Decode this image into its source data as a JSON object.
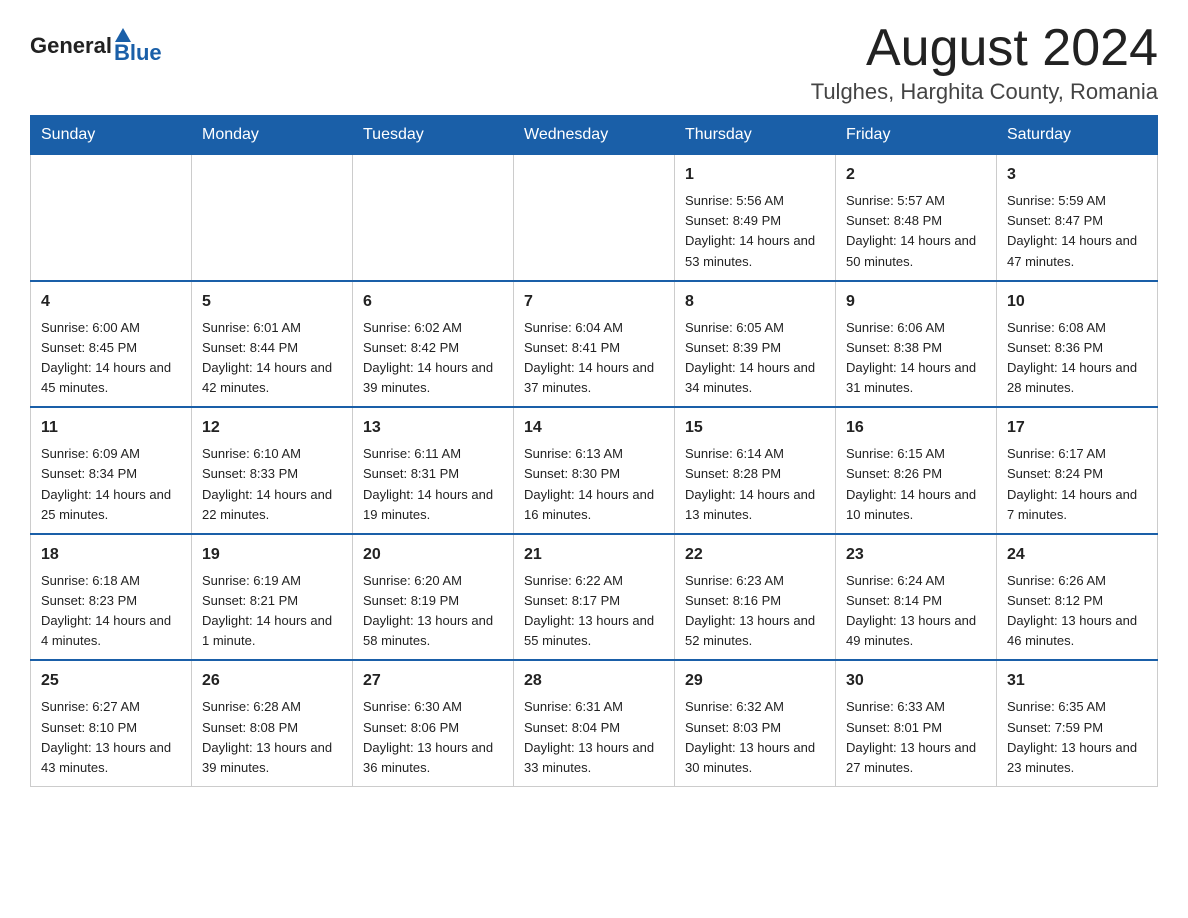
{
  "header": {
    "logo_general": "General",
    "logo_blue": "Blue",
    "month_year": "August 2024",
    "location": "Tulghes, Harghita County, Romania"
  },
  "days_of_week": [
    "Sunday",
    "Monday",
    "Tuesday",
    "Wednesday",
    "Thursday",
    "Friday",
    "Saturday"
  ],
  "weeks": [
    [
      {
        "day": "",
        "info": ""
      },
      {
        "day": "",
        "info": ""
      },
      {
        "day": "",
        "info": ""
      },
      {
        "day": "",
        "info": ""
      },
      {
        "day": "1",
        "info": "Sunrise: 5:56 AM\nSunset: 8:49 PM\nDaylight: 14 hours and 53 minutes."
      },
      {
        "day": "2",
        "info": "Sunrise: 5:57 AM\nSunset: 8:48 PM\nDaylight: 14 hours and 50 minutes."
      },
      {
        "day": "3",
        "info": "Sunrise: 5:59 AM\nSunset: 8:47 PM\nDaylight: 14 hours and 47 minutes."
      }
    ],
    [
      {
        "day": "4",
        "info": "Sunrise: 6:00 AM\nSunset: 8:45 PM\nDaylight: 14 hours and 45 minutes."
      },
      {
        "day": "5",
        "info": "Sunrise: 6:01 AM\nSunset: 8:44 PM\nDaylight: 14 hours and 42 minutes."
      },
      {
        "day": "6",
        "info": "Sunrise: 6:02 AM\nSunset: 8:42 PM\nDaylight: 14 hours and 39 minutes."
      },
      {
        "day": "7",
        "info": "Sunrise: 6:04 AM\nSunset: 8:41 PM\nDaylight: 14 hours and 37 minutes."
      },
      {
        "day": "8",
        "info": "Sunrise: 6:05 AM\nSunset: 8:39 PM\nDaylight: 14 hours and 34 minutes."
      },
      {
        "day": "9",
        "info": "Sunrise: 6:06 AM\nSunset: 8:38 PM\nDaylight: 14 hours and 31 minutes."
      },
      {
        "day": "10",
        "info": "Sunrise: 6:08 AM\nSunset: 8:36 PM\nDaylight: 14 hours and 28 minutes."
      }
    ],
    [
      {
        "day": "11",
        "info": "Sunrise: 6:09 AM\nSunset: 8:34 PM\nDaylight: 14 hours and 25 minutes."
      },
      {
        "day": "12",
        "info": "Sunrise: 6:10 AM\nSunset: 8:33 PM\nDaylight: 14 hours and 22 minutes."
      },
      {
        "day": "13",
        "info": "Sunrise: 6:11 AM\nSunset: 8:31 PM\nDaylight: 14 hours and 19 minutes."
      },
      {
        "day": "14",
        "info": "Sunrise: 6:13 AM\nSunset: 8:30 PM\nDaylight: 14 hours and 16 minutes."
      },
      {
        "day": "15",
        "info": "Sunrise: 6:14 AM\nSunset: 8:28 PM\nDaylight: 14 hours and 13 minutes."
      },
      {
        "day": "16",
        "info": "Sunrise: 6:15 AM\nSunset: 8:26 PM\nDaylight: 14 hours and 10 minutes."
      },
      {
        "day": "17",
        "info": "Sunrise: 6:17 AM\nSunset: 8:24 PM\nDaylight: 14 hours and 7 minutes."
      }
    ],
    [
      {
        "day": "18",
        "info": "Sunrise: 6:18 AM\nSunset: 8:23 PM\nDaylight: 14 hours and 4 minutes."
      },
      {
        "day": "19",
        "info": "Sunrise: 6:19 AM\nSunset: 8:21 PM\nDaylight: 14 hours and 1 minute."
      },
      {
        "day": "20",
        "info": "Sunrise: 6:20 AM\nSunset: 8:19 PM\nDaylight: 13 hours and 58 minutes."
      },
      {
        "day": "21",
        "info": "Sunrise: 6:22 AM\nSunset: 8:17 PM\nDaylight: 13 hours and 55 minutes."
      },
      {
        "day": "22",
        "info": "Sunrise: 6:23 AM\nSunset: 8:16 PM\nDaylight: 13 hours and 52 minutes."
      },
      {
        "day": "23",
        "info": "Sunrise: 6:24 AM\nSunset: 8:14 PM\nDaylight: 13 hours and 49 minutes."
      },
      {
        "day": "24",
        "info": "Sunrise: 6:26 AM\nSunset: 8:12 PM\nDaylight: 13 hours and 46 minutes."
      }
    ],
    [
      {
        "day": "25",
        "info": "Sunrise: 6:27 AM\nSunset: 8:10 PM\nDaylight: 13 hours and 43 minutes."
      },
      {
        "day": "26",
        "info": "Sunrise: 6:28 AM\nSunset: 8:08 PM\nDaylight: 13 hours and 39 minutes."
      },
      {
        "day": "27",
        "info": "Sunrise: 6:30 AM\nSunset: 8:06 PM\nDaylight: 13 hours and 36 minutes."
      },
      {
        "day": "28",
        "info": "Sunrise: 6:31 AM\nSunset: 8:04 PM\nDaylight: 13 hours and 33 minutes."
      },
      {
        "day": "29",
        "info": "Sunrise: 6:32 AM\nSunset: 8:03 PM\nDaylight: 13 hours and 30 minutes."
      },
      {
        "day": "30",
        "info": "Sunrise: 6:33 AM\nSunset: 8:01 PM\nDaylight: 13 hours and 27 minutes."
      },
      {
        "day": "31",
        "info": "Sunrise: 6:35 AM\nSunset: 7:59 PM\nDaylight: 13 hours and 23 minutes."
      }
    ]
  ]
}
